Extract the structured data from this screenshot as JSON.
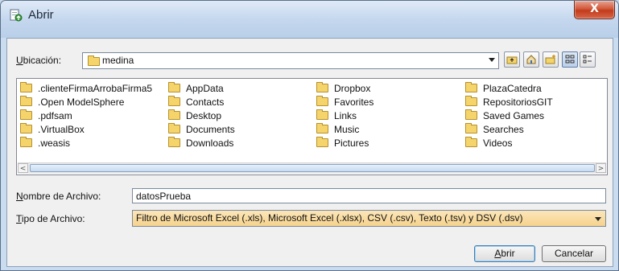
{
  "window": {
    "title": "Abrir",
    "close_symbol": "X"
  },
  "location": {
    "label_first": "U",
    "label_rest": "bicación:",
    "value": "medina"
  },
  "toolbar": {
    "up_icon": "folder-up-icon",
    "home_icon": "home-icon",
    "new_folder_icon": "new-folder-icon",
    "list_view_icon": "list-view-icon",
    "details_view_icon": "details-view-icon"
  },
  "files": {
    "col1": [
      ".clienteFirmaArrobaFirma5",
      ".Open ModelSphere",
      ".pdfsam",
      ".VirtualBox",
      ".weasis"
    ],
    "col2": [
      "AppData",
      "Contacts",
      "Desktop",
      "Documents",
      "Downloads"
    ],
    "col3": [
      "Dropbox",
      "Favorites",
      "Links",
      "Music",
      "Pictures"
    ],
    "col4": [
      "PlazaCatedra",
      "RepositoriosGIT",
      "Saved Games",
      "Searches",
      "Videos"
    ]
  },
  "filename": {
    "label_first": "N",
    "label_rest": "ombre de Archivo:",
    "value": "datosPrueba"
  },
  "filetype": {
    "label_first": "T",
    "label_rest": "ipo de Archivo:",
    "value": "Filtro de Microsoft Excel (.xls), Microsoft Excel (.xlsx), CSV (.csv), Texto (.tsv) y DSV (.dsv)"
  },
  "buttons": {
    "open_first": "A",
    "open_rest": "brir",
    "cancel": "Cancelar"
  },
  "scrollbar": {
    "left": "<",
    "right": ">"
  }
}
